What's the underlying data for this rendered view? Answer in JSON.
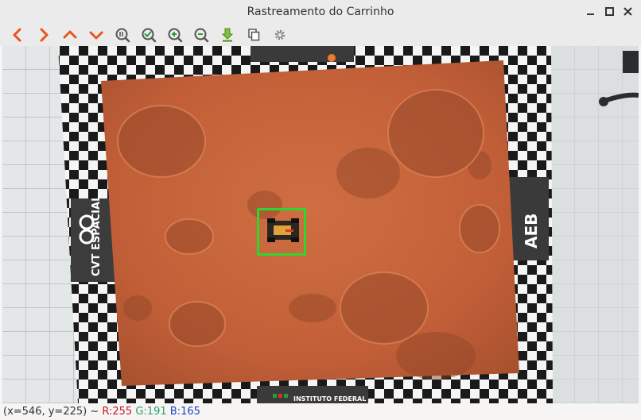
{
  "window": {
    "title": "Rastreamento do Carrinho"
  },
  "toolbar": {
    "buttons": [
      {
        "name": "pan-left",
        "icon": "chevron-left-icon"
      },
      {
        "name": "pan-right",
        "icon": "chevron-right-icon"
      },
      {
        "name": "pan-up",
        "icon": "chevron-up-icon"
      },
      {
        "name": "pan-down",
        "icon": "chevron-down-icon"
      },
      {
        "name": "zoom-original",
        "icon": "zoom-100-icon"
      },
      {
        "name": "zoom-fit",
        "icon": "zoom-fit-check-icon"
      },
      {
        "name": "zoom-in",
        "icon": "zoom-in-icon"
      },
      {
        "name": "zoom-out",
        "icon": "zoom-out-icon"
      },
      {
        "name": "save-image",
        "icon": "save-arrow-icon"
      },
      {
        "name": "copy-image",
        "icon": "copy-icon"
      },
      {
        "name": "properties",
        "icon": "gear-icon"
      }
    ]
  },
  "image": {
    "board_labels": {
      "left": "CVT ESPACIAL",
      "right": "AEB",
      "bottom": "INSTITUTO FEDERAL"
    },
    "tracking_box_color": "#2fd62f"
  },
  "status": {
    "coords": "(x=546, y=225) ~",
    "r": "R:255",
    "g": "G:191",
    "b": "B:165"
  },
  "colors": {
    "accent_orange": "#e95420",
    "toolbar_green": "#2b9b3c"
  }
}
